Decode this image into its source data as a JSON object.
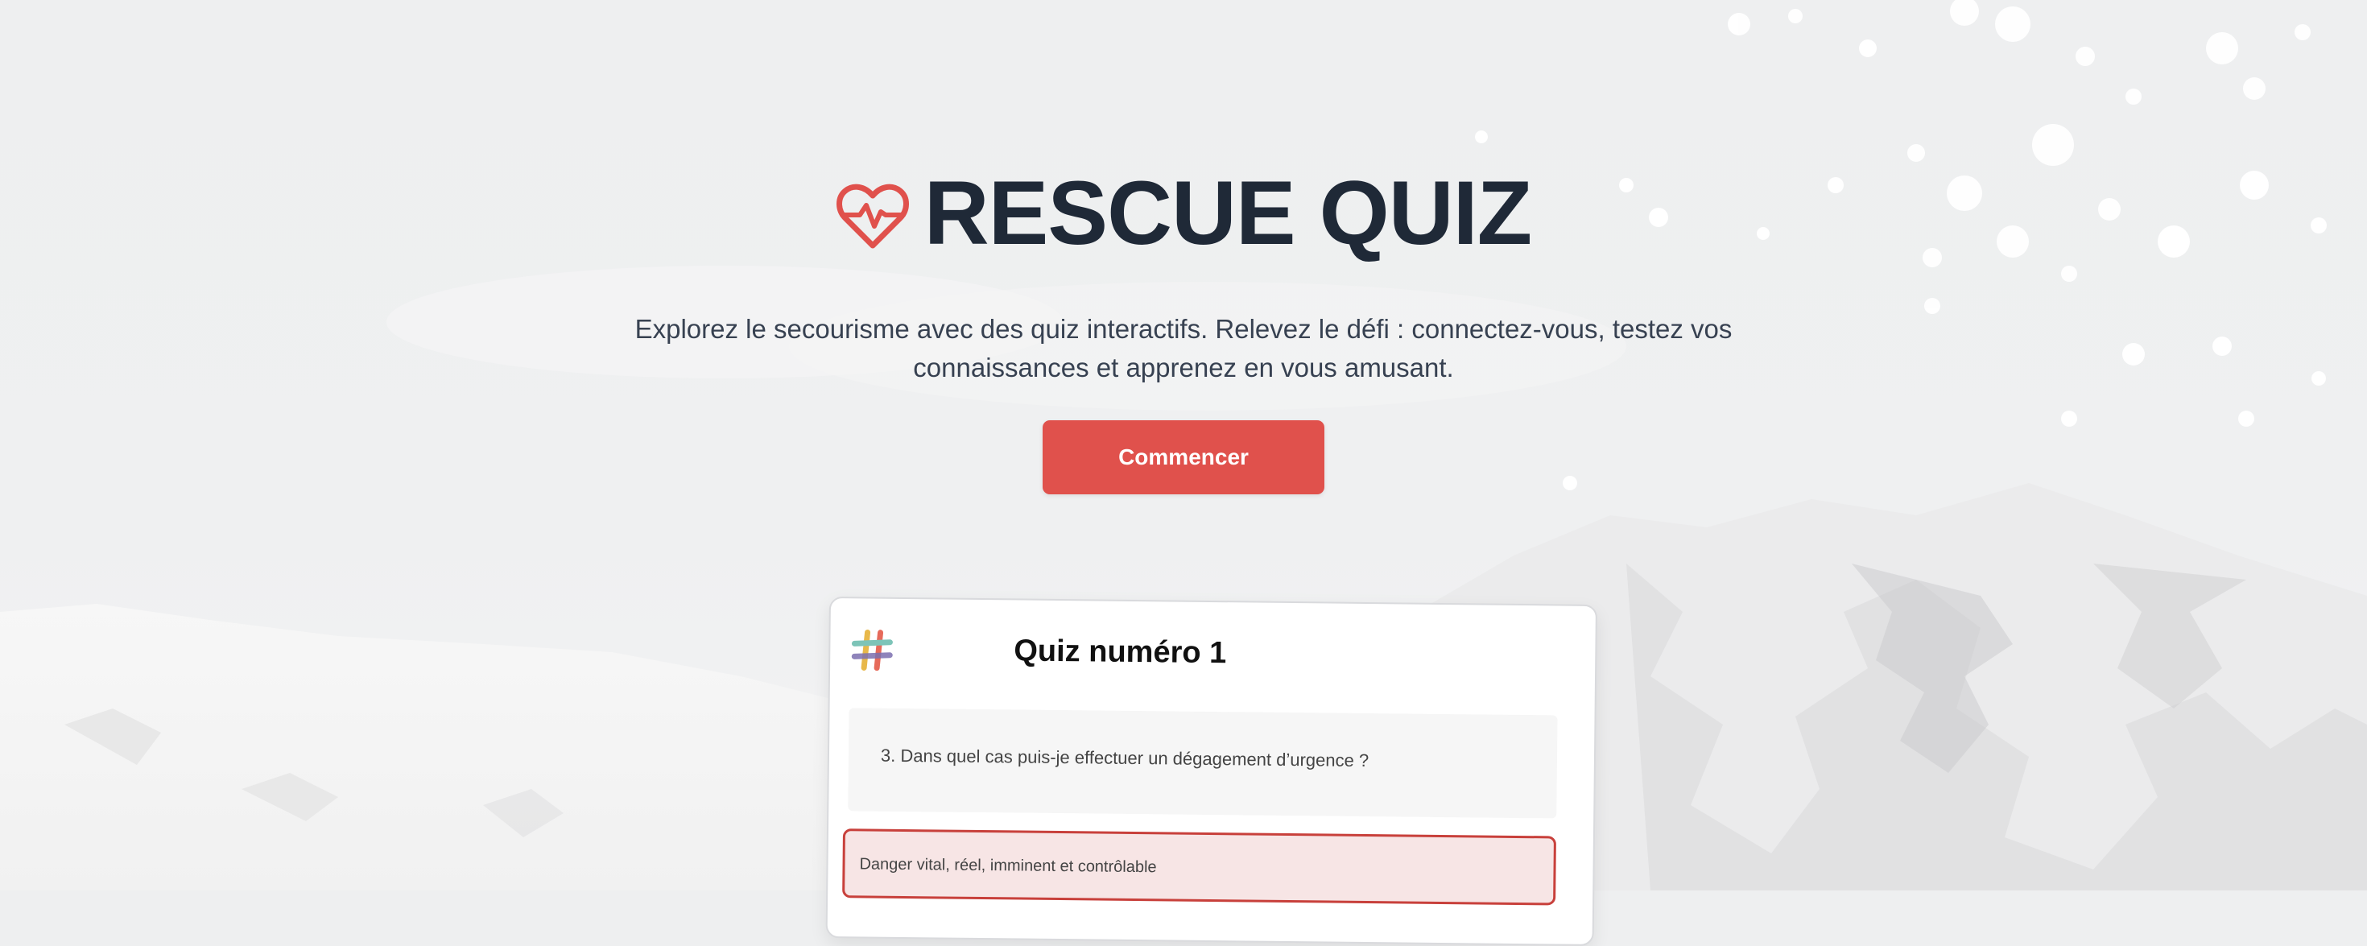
{
  "hero": {
    "title": "RESCUE QUIZ",
    "tagline": "Explorez le secourisme avec des quiz interactifs. Relevez le défi : connectez-vous, testez vos connaissances et apprenez en vous amusant.",
    "cta_label": "Commencer"
  },
  "quiz_card": {
    "title": "Quiz numéro 1",
    "question": "3. Dans quel cas puis-je effectuer un dégagement d’urgence ?",
    "answers": [
      {
        "label": "Danger vital, réel, imminent et contrôlable",
        "state": "selected"
      }
    ]
  },
  "icons": {
    "brand": "heart-pulse-icon",
    "card": "hash-logo-icon"
  },
  "colors": {
    "accent": "#e0514c",
    "title_text": "#1f2937",
    "body_text": "#374151",
    "answer_border": "#c8403b",
    "answer_bg": "#f7e5e5",
    "background": "#eeeff0"
  }
}
